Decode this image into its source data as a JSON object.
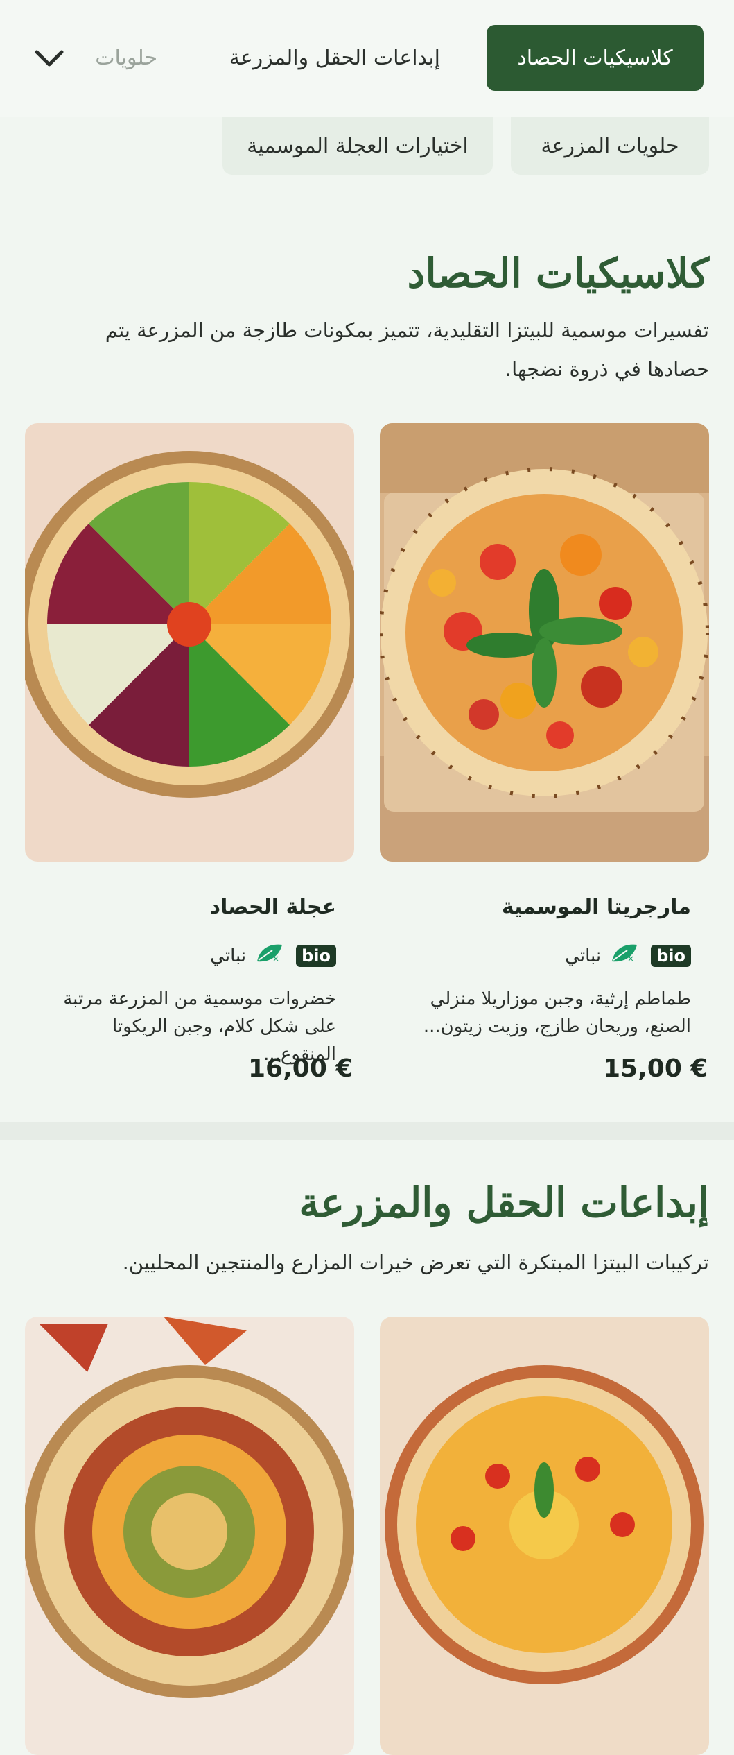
{
  "nav": {
    "tabs": [
      {
        "label": "كلاسيكيات الحصاد",
        "active": true
      },
      {
        "label": "إبداعات الحقل والمزرعة",
        "active": false
      },
      {
        "label": "حلويات",
        "active": false
      }
    ],
    "more_icon": "chevron-down-icon",
    "secondary": [
      {
        "label": "حلويات المزرعة"
      },
      {
        "label": "اختيارات العجلة الموسمية"
      }
    ]
  },
  "sections": [
    {
      "title": "كلاسيكيات الحصاد",
      "description": "تفسيرات موسمية للبيتزا التقليدية، تتميز بمكونات طازجة من المزرعة يتم حصادها في ذروة نضجها.",
      "items": [
        {
          "name": "مارجريتا الموسمية",
          "badge": "bio",
          "diet": "نباتي",
          "description": "طماطم إرثية، وجبن موزاريلا منزلي الصنع، وريحان طازج، وزيت زيتون...",
          "price": "15,00 €"
        },
        {
          "name": "عجلة الحصاد",
          "badge": "bio",
          "diet": "نباتي",
          "description": "خضروات موسمية من المزرعة مرتبة على شكل كلام، وجبن الريكوتا المنقوع...",
          "price": "16,00 €"
        }
      ]
    },
    {
      "title": "إبداعات الحقل والمزرعة",
      "description": "تركيبات البيتزا المبتكرة التي تعرض خيرات المزارع والمنتجين المحليين."
    }
  ],
  "colors": {
    "accent": "#2c5a32",
    "title": "#2f5c35",
    "background": "#f1f6f1",
    "badge": "#1e3a26",
    "leaf": "#1aa06a"
  }
}
